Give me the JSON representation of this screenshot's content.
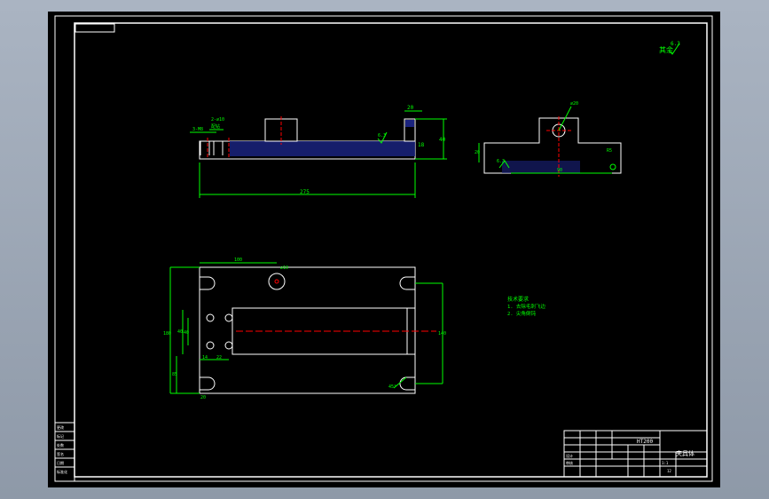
{
  "drawing": {
    "roughness_symbol": "其余",
    "roughness_value": "6.3",
    "tech_requirements": {
      "title": "技术要求",
      "items": [
        "1. 去除毛刺飞边",
        "2. 尖角倒钝"
      ]
    },
    "dims": {
      "total_length": "275",
      "top_length": "100",
      "height_left": "180",
      "slot_spacing": "140",
      "small_top": "40",
      "hole_label": "∅10",
      "angle_label": "45°",
      "hole_note": "2-∅10",
      "hole_note2": "配钻",
      "callout_a": "3-M8",
      "side_width": "20",
      "side_height": "40",
      "right_hole": "∅20",
      "right_width": "90",
      "right_dim_left": "20",
      "bottom_a": "14",
      "bottom_b": "22",
      "left_a": "40",
      "left_b": "85",
      "small_a": "18",
      "right_r": "R5"
    },
    "title_block": {
      "material": "HT200",
      "part_name": "夹具体",
      "scale": "1:1",
      "sheet": "12",
      "label_a": "设计",
      "label_b": "审核"
    },
    "side_table": [
      "更改",
      "标记",
      "处数",
      "签名",
      "日期",
      "标准化"
    ]
  }
}
